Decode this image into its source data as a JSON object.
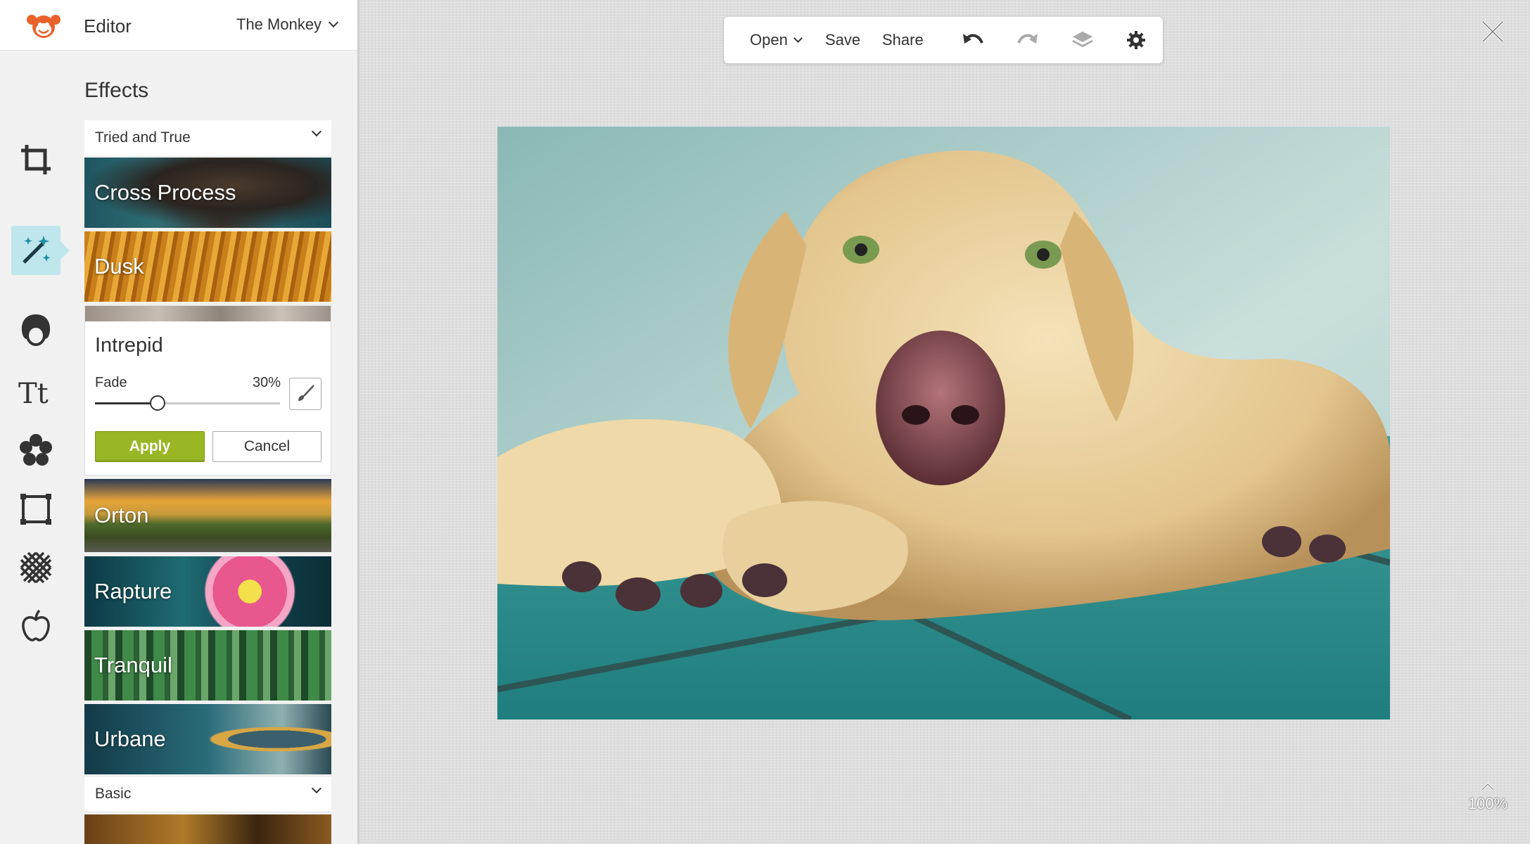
{
  "header": {
    "app_title": "Editor",
    "profile_name": "The Monkey"
  },
  "effects": {
    "heading": "Effects",
    "category_selected": "Tried and True",
    "items": [
      {
        "label": "Cross Process"
      },
      {
        "label": "Dusk"
      },
      {
        "label": "Orton"
      },
      {
        "label": "Rapture"
      },
      {
        "label": "Tranquil"
      },
      {
        "label": "Urbane"
      }
    ],
    "active_effect": {
      "title": "Intrepid",
      "fade_label": "Fade",
      "fade_value_text": "30%",
      "fade_fraction": 0.3,
      "apply_label": "Apply",
      "cancel_label": "Cancel"
    },
    "next_category": "Basic"
  },
  "toolbar": {
    "open_label": "Open",
    "save_label": "Save",
    "share_label": "Share",
    "icons": [
      "undo-icon",
      "redo-icon",
      "layers-icon",
      "gear-icon"
    ]
  },
  "tools": [
    "crop-icon",
    "effects-wand-icon",
    "touch-up-face-icon",
    "text-icon",
    "overlays-icon",
    "frames-icon",
    "textures-icon",
    "seasonal-apple-icon"
  ],
  "zoom": {
    "value": "100%"
  },
  "colors": {
    "accent_active": "#bfe6ec",
    "apply_green": "#99b625",
    "logo_orange": "#e8632b"
  }
}
